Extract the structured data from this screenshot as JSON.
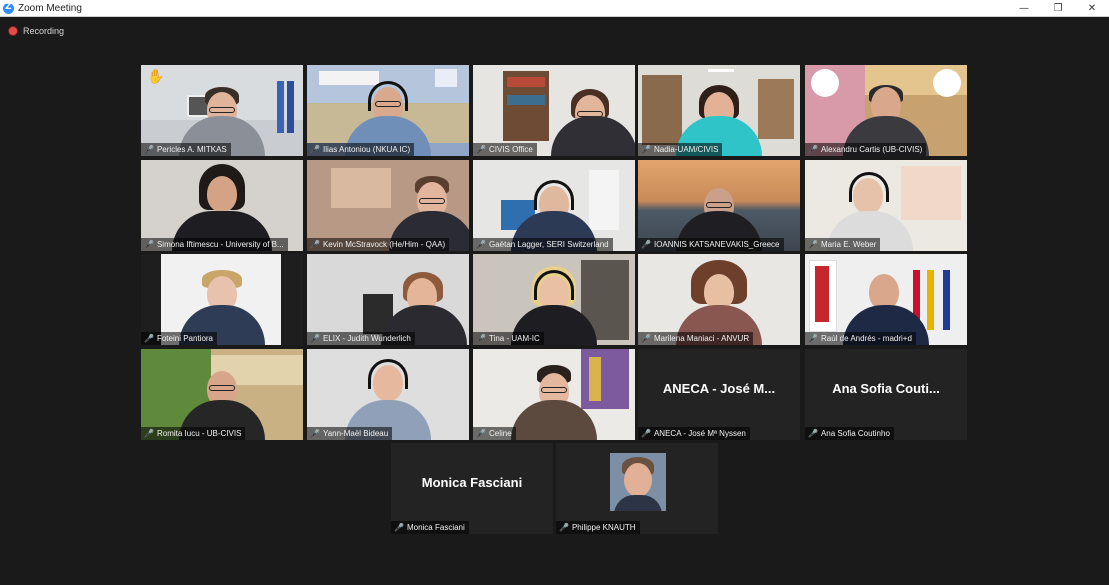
{
  "window": {
    "title": "Zoom Meeting",
    "controls": {
      "minimize": "—",
      "restore": "❐",
      "close": "✕"
    }
  },
  "recording": {
    "label": "Recording"
  },
  "participants": [
    {
      "name": "Pericles A. MITKAS",
      "raised_hand": true
    },
    {
      "name": "Ilias Antoniou (NKUA IC)"
    },
    {
      "name": "CIVIS Office"
    },
    {
      "name": "Nadia-UAM/CIVIS",
      "active_speaker": true
    },
    {
      "name": "Alexandru Cartis (UB-CIVIS)"
    },
    {
      "name": "Simona Iftimescu - University of B..."
    },
    {
      "name": "Kevin McStravock (He/Him - QAA)"
    },
    {
      "name": "Gaëtan Lagger, SERI Switzerland"
    },
    {
      "name": "IOANNIS KATSANEVAKIS_Greece"
    },
    {
      "name": "Maria E. Weber"
    },
    {
      "name": "Foteini Pantiora"
    },
    {
      "name": "ELIX - Judith Wunderlich"
    },
    {
      "name": "Tina - UAM-IC"
    },
    {
      "name": "Marilena Maniaci - ANVUR"
    },
    {
      "name": "Raúl de Andrés - madri+d"
    },
    {
      "name": "Romita Iucu - UB-CIVIS"
    },
    {
      "name": "Yann-Maël Bideau"
    },
    {
      "name": "Celine"
    },
    {
      "name": "ANECA - José Mª Nyssen",
      "display_name": "ANECA - José M..."
    },
    {
      "name": "Ana Sofia Coutinho",
      "display_name": "Ana Sofia Couti..."
    },
    {
      "name": "Monica Fasciani",
      "display_name": "Monica Fasciani"
    },
    {
      "name": "Philippe KNAUTH"
    }
  ],
  "colors": {
    "background": "#1a1a1a",
    "active_speaker_border": "#c7d93b",
    "muted_icon": "#e5443d",
    "recording_dot": "#e34b4b"
  },
  "icons": {
    "muted": "microphone-muted-icon",
    "hand": "raised-hand-icon",
    "recording": "recording-dot-icon"
  }
}
